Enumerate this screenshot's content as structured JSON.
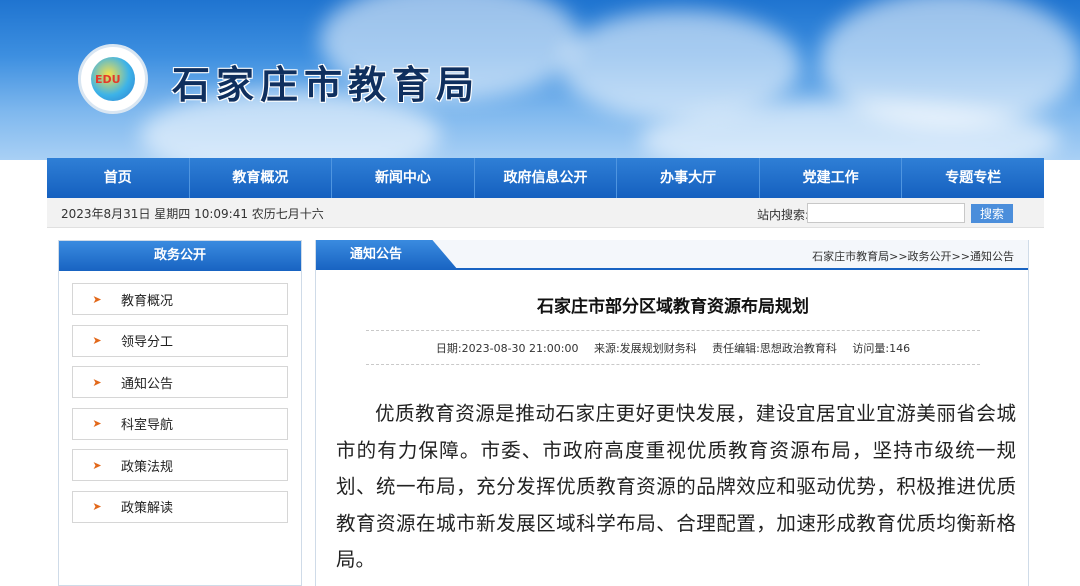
{
  "header": {
    "logo_text": "EDU",
    "site_title": "石家庄市教育局"
  },
  "nav": {
    "items": [
      "首页",
      "教育概况",
      "新闻中心",
      "政府信息公开",
      "办事大厅",
      "党建工作",
      "专题专栏"
    ]
  },
  "infobar": {
    "datetime": "2023年8月31日 星期四 10:09:41 农历七月十六",
    "search_label": "站内搜索:",
    "search_value": "",
    "search_button": "搜索"
  },
  "sidebar": {
    "title": "政务公开",
    "items": [
      "教育概况",
      "领导分工",
      "通知公告",
      "科室导航",
      "政策法规",
      "政策解读"
    ]
  },
  "content": {
    "tab": "通知公告",
    "breadcrumb": "石家庄市教育局>>政务公开>>通知公告",
    "title": "石家庄市部分区域教育资源布局规划",
    "meta": {
      "date": "日期:2023-08-30 21:00:00",
      "source": "来源:发展规划财务科",
      "editor": "责任编辑:思想政治教育科",
      "views": "访问量:146"
    },
    "paragraph": "优质教育资源是推动石家庄更好更快发展，建设宜居宜业宜游美丽省会城市的有力保障。市委、市政府高度重视优质教育资源布局，坚持市级统一规划、统一布局，充分发挥优质教育资源的品牌效应和驱动优势，积极推进优质教育资源在城市新发展区域科学布局、合理配置，加速形成教育优质均衡新格局。"
  }
}
